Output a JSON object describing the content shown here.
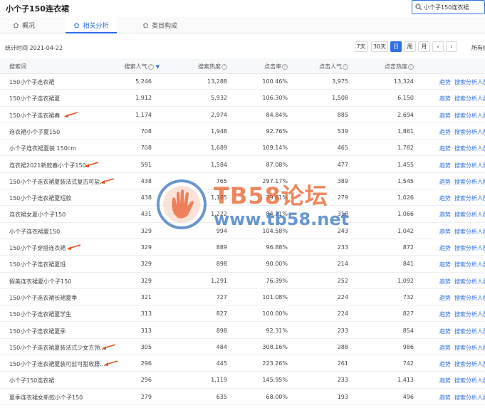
{
  "header": {
    "title": "小个子150连衣裙",
    "search_value": "小个子150连衣裙"
  },
  "tabs": [
    {
      "label": "概况",
      "icon": "home-icon",
      "active": false
    },
    {
      "label": "相关分析",
      "icon": "home-icon",
      "active": true
    },
    {
      "label": "类目构成",
      "icon": "home-icon",
      "active": false
    }
  ],
  "stat": {
    "time_label": "统计时间 2021-04-22",
    "periods": [
      "7天",
      "30天",
      "日",
      "周",
      "月"
    ],
    "active_period": "日",
    "prev": "‹",
    "next": "›",
    "all_devices": "所有终端"
  },
  "table": {
    "columns": [
      "搜索词",
      "搜索人气",
      "搜索热度",
      "点击率",
      "点击人气",
      "点击热度"
    ],
    "actions": [
      "趋势",
      "搜索分析",
      "人群分析"
    ],
    "rows": [
      {
        "keyword": "150小个子连衣裙",
        "search_pop": "5,246",
        "search_heat": "13,288",
        "ctr": "100.46%",
        "click_pop": "3,975",
        "click_heat": "13,324",
        "arrow": false
      },
      {
        "keyword": "150小个子连衣裙夏",
        "search_pop": "1,912",
        "search_heat": "5,932",
        "ctr": "106.30%",
        "click_pop": "1,508",
        "click_heat": "6,150",
        "arrow": false
      },
      {
        "keyword": "150小个子连衣裙春",
        "search_pop": "1,174",
        "search_heat": "2,974",
        "ctr": "84.84%",
        "click_pop": "885",
        "click_heat": "2,694",
        "arrow": true
      },
      {
        "keyword": "连衣裙小个子夏150",
        "search_pop": "708",
        "search_heat": "1,948",
        "ctr": "92.76%",
        "click_pop": "539",
        "click_heat": "1,861",
        "arrow": false
      },
      {
        "keyword": "小个子连衣裙夏装 150cm",
        "search_pop": "708",
        "search_heat": "1,689",
        "ctr": "109.14%",
        "click_pop": "465",
        "click_heat": "1,782",
        "arrow": false
      },
      {
        "keyword": "连衣裙2021新款春小个子150",
        "search_pop": "591",
        "search_heat": "1,584",
        "ctr": "87.08%",
        "click_pop": "477",
        "click_heat": "1,455",
        "arrow": true
      },
      {
        "keyword": "150小个子连衣裙夏装法式复古可盐...",
        "search_pop": "438",
        "search_heat": "765",
        "ctr": "297.17%",
        "click_pop": "389",
        "click_heat": "1,545",
        "arrow": true
      },
      {
        "keyword": "150小个子连衣裙夏短款",
        "search_pop": "438",
        "search_heat": "1,185",
        "ctr": "79.81%",
        "click_pop": "279",
        "click_heat": "1,026",
        "arrow": false
      },
      {
        "keyword": "连衣裙女夏小个子150",
        "search_pop": "431",
        "search_heat": "1,222",
        "ctr": "84.21%",
        "click_pop": "318",
        "click_heat": "1,066",
        "arrow": false
      },
      {
        "keyword": "小个子连衣裙夏150",
        "search_pop": "329",
        "search_heat": "994",
        "ctr": "104.58%",
        "click_pop": "243",
        "click_heat": "1,042",
        "arrow": false
      },
      {
        "keyword": "150小个子穿搭连衣裙",
        "search_pop": "329",
        "search_heat": "889",
        "ctr": "96.88%",
        "click_pop": "233",
        "click_heat": "872",
        "arrow": true
      },
      {
        "keyword": "150小个子连衣裙夏班",
        "search_pop": "329",
        "search_heat": "898",
        "ctr": "90.00%",
        "click_pop": "214",
        "click_heat": "841",
        "arrow": false
      },
      {
        "keyword": "假美连衣裙夏小个子150",
        "search_pop": "329",
        "search_heat": "1,291",
        "ctr": "76.39%",
        "click_pop": "252",
        "click_heat": "1,092",
        "arrow": false
      },
      {
        "keyword": "150小个子连衣裙长裙夏季",
        "search_pop": "321",
        "search_heat": "727",
        "ctr": "101.08%",
        "click_pop": "224",
        "click_heat": "732",
        "arrow": false
      },
      {
        "keyword": "150小个子连衣裙夏学生",
        "search_pop": "313",
        "search_heat": "827",
        "ctr": "100.00%",
        "click_pop": "224",
        "click_heat": "827",
        "arrow": false
      },
      {
        "keyword": "150小个子连衣裙夏季",
        "search_pop": "313",
        "search_heat": "898",
        "ctr": "92.31%",
        "click_pop": "233",
        "click_heat": "854",
        "arrow": false
      },
      {
        "keyword": "150小个子连衣裙夏装法式少女方领...",
        "search_pop": "305",
        "search_heat": "484",
        "ctr": "308.16%",
        "click_pop": "288",
        "click_heat": "986",
        "arrow": true
      },
      {
        "keyword": "150小个子连衣裙夏装可盐可甜收腰...",
        "search_pop": "296",
        "search_heat": "445",
        "ctr": "223.26%",
        "click_pop": "261",
        "click_heat": "742",
        "arrow": true
      },
      {
        "keyword": "小个子150连衣裙",
        "search_pop": "296",
        "search_heat": "1,119",
        "ctr": "145.95%",
        "click_pop": "233",
        "click_heat": "1,413",
        "arrow": false
      },
      {
        "keyword": "夏季连衣裙女新款小个子150",
        "search_pop": "279",
        "search_heat": "635",
        "ctr": "68.00%",
        "click_pop": "193",
        "click_heat": "496",
        "arrow": false
      }
    ]
  },
  "watermark": {
    "title": "TB58论坛",
    "url": "www.tb58.net"
  },
  "colors": {
    "accent": "#2f6fe8",
    "arrow": "#e8501e",
    "watermark_title": "#e85a20",
    "watermark_url": "#2f6fbf"
  }
}
